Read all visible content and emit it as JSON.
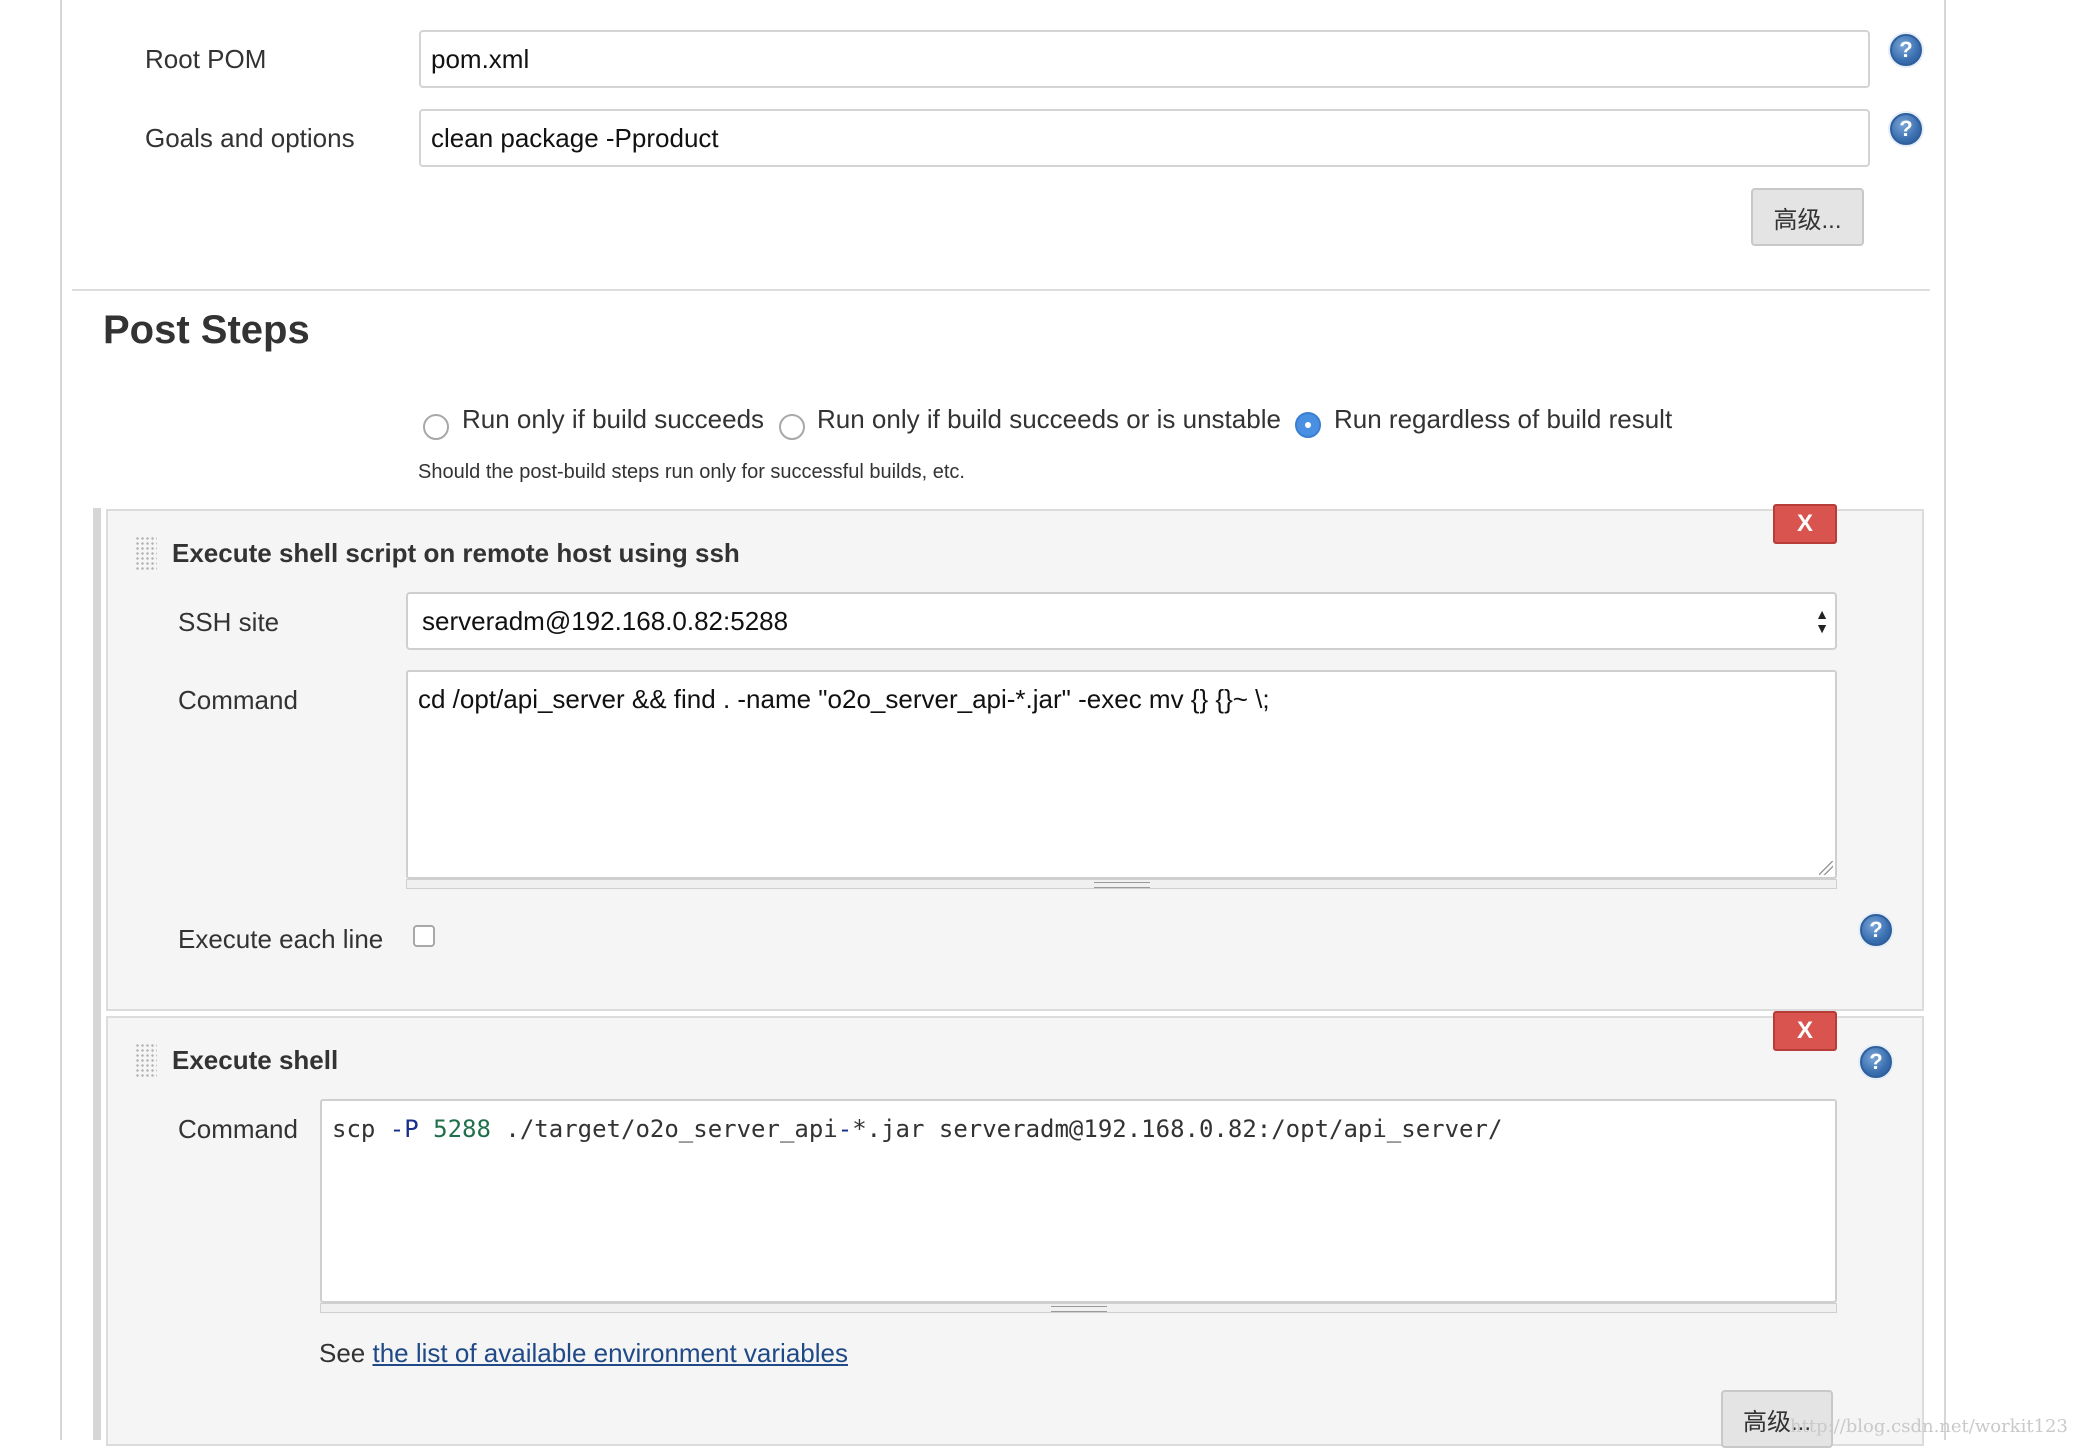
{
  "build": {
    "root_pom": {
      "label": "Root POM",
      "value": "pom.xml"
    },
    "goals": {
      "label": "Goals and options",
      "value": "clean package -Pproduct"
    },
    "advanced_label": "高级...",
    "help_glyph": "?"
  },
  "post_steps": {
    "title": "Post Steps",
    "radio_options": [
      {
        "label": "Run only if build succeeds",
        "checked": false
      },
      {
        "label": "Run only if build succeeds or is unstable",
        "checked": false
      },
      {
        "label": "Run regardless of build result",
        "checked": true
      }
    ],
    "description": "Should the post-build steps run only for successful builds, etc."
  },
  "ssh_step": {
    "title": "Execute shell script on remote host using ssh",
    "delete_label": "X",
    "ssh_site_label": "SSH site",
    "ssh_site_value": "serveradm@192.168.0.82:5288",
    "command_label": "Command",
    "command_value": "cd /opt/api_server && find . -name \"o2o_server_api-*.jar\" -exec mv {} {}~ \\;",
    "execute_each_line_label": "Execute each line",
    "execute_each_line_checked": false
  },
  "shell_step": {
    "title": "Execute shell",
    "delete_label": "X",
    "command_label": "Command",
    "command_tokens": {
      "cmd": "scp ",
      "flag": "-P",
      "space1": " ",
      "port": "5288",
      "path1": " ./target/o2o_server_api",
      "dash": "-",
      "rest": "*.jar serveradm@192.168.0.82:/opt/api_server/"
    },
    "see_prefix": "See ",
    "env_link": "the list of available environment variables",
    "advanced_label": "高级..."
  },
  "watermark": "http://blog.csdn.net/workit123",
  "colors": {
    "delete_button": "#d9534f",
    "help_icon": "#3a6fb0",
    "radio_checked": "#4a90e2",
    "link": "#204a87"
  },
  "icons": {
    "help": "help-icon",
    "delete": "close-icon",
    "drag": "drag-handle-icon",
    "select": "select-arrows-icon"
  }
}
